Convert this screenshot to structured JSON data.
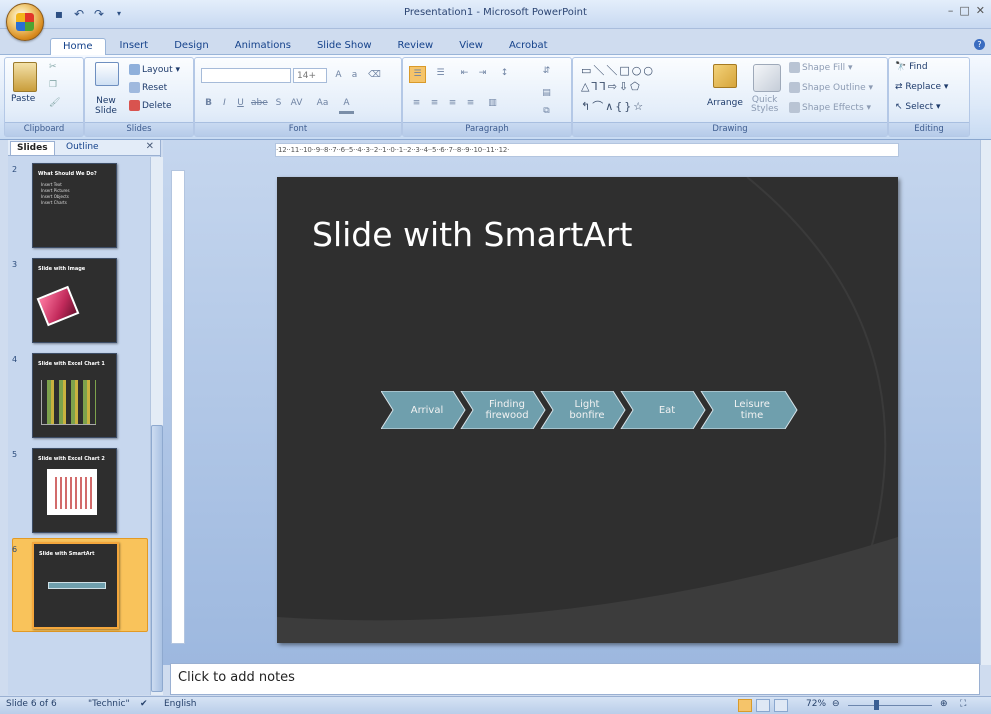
{
  "window": {
    "title": "Presentation1 - Microsoft PowerPoint",
    "controls": [
      "–",
      "□",
      "✕"
    ]
  },
  "ribbon_tabs": [
    "Home",
    "Insert",
    "Design",
    "Animations",
    "Slide Show",
    "Review",
    "View",
    "Acrobat"
  ],
  "active_tab": "Home",
  "groups": {
    "clipboard": {
      "label": "Clipboard",
      "paste": "Paste"
    },
    "slides": {
      "label": "Slides",
      "new_slide": "New\nSlide",
      "layout": "Layout",
      "reset": "Reset",
      "delete": "Delete"
    },
    "font": {
      "label": "Font",
      "size": "14+",
      "bold": "B",
      "italic": "I",
      "underline": "U",
      "strike": "abe",
      "shadow": "S",
      "spacing": "AV",
      "case": "Aa",
      "color": "A"
    },
    "paragraph": {
      "label": "Paragraph"
    },
    "drawing": {
      "label": "Drawing",
      "arrange": "Arrange",
      "quick_styles": "Quick\nStyles",
      "shape_fill": "Shape Fill",
      "shape_outline": "Shape Outline",
      "shape_effects": "Shape Effects"
    },
    "editing": {
      "label": "Editing",
      "find": "Find",
      "replace": "Replace",
      "select": "Select"
    }
  },
  "pane_tabs": [
    "Slides",
    "Outline"
  ],
  "thumbnails": [
    {
      "num": "2",
      "title": "What Should We Do?",
      "bullets": [
        "Insert Text",
        "Insert Pictures",
        "Insert Objects",
        "Insert Charts"
      ]
    },
    {
      "num": "3",
      "title": "Slide with Image"
    },
    {
      "num": "4",
      "title": "Slide with Excel Chart 1"
    },
    {
      "num": "5",
      "title": "Slide with Excel Chart 2"
    },
    {
      "num": "6",
      "title": "Slide with SmartArt"
    }
  ],
  "ruler_text": "·12··11··10··9··8··7··6··5··4··3··2··1··0··1··2··3··4··5··6··7··8··9··10··11··12·",
  "slide": {
    "title": "Slide with SmartArt",
    "smartart": [
      "Arrival",
      "Finding\nfirewood",
      "Light\nbonfire",
      "Eat",
      "Leisure\ntime"
    ],
    "colors": {
      "background": "#2f2f2f",
      "chevron": "#6f9fad",
      "chevron_border": "#d8e4ea"
    }
  },
  "notes_placeholder": "Click to add notes",
  "status": {
    "slide": "Slide 6 of 6",
    "theme": "\"Technic\"",
    "language": "English",
    "zoom": "72%"
  }
}
